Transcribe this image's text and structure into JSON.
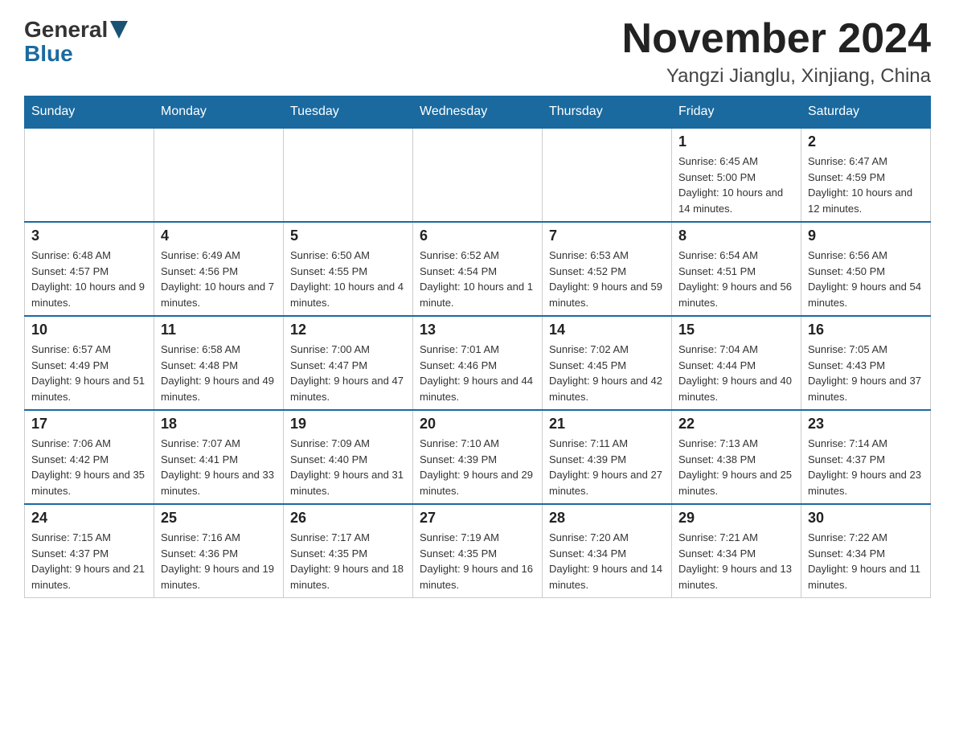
{
  "header": {
    "month_title": "November 2024",
    "location": "Yangzi Jianglu, Xinjiang, China",
    "logo_general": "General",
    "logo_blue": "Blue"
  },
  "weekdays": [
    "Sunday",
    "Monday",
    "Tuesday",
    "Wednesday",
    "Thursday",
    "Friday",
    "Saturday"
  ],
  "weeks": [
    [
      {
        "day": "",
        "sunrise": "",
        "sunset": "",
        "daylight": ""
      },
      {
        "day": "",
        "sunrise": "",
        "sunset": "",
        "daylight": ""
      },
      {
        "day": "",
        "sunrise": "",
        "sunset": "",
        "daylight": ""
      },
      {
        "day": "",
        "sunrise": "",
        "sunset": "",
        "daylight": ""
      },
      {
        "day": "",
        "sunrise": "",
        "sunset": "",
        "daylight": ""
      },
      {
        "day": "1",
        "sunrise": "Sunrise: 6:45 AM",
        "sunset": "Sunset: 5:00 PM",
        "daylight": "Daylight: 10 hours and 14 minutes."
      },
      {
        "day": "2",
        "sunrise": "Sunrise: 6:47 AM",
        "sunset": "Sunset: 4:59 PM",
        "daylight": "Daylight: 10 hours and 12 minutes."
      }
    ],
    [
      {
        "day": "3",
        "sunrise": "Sunrise: 6:48 AM",
        "sunset": "Sunset: 4:57 PM",
        "daylight": "Daylight: 10 hours and 9 minutes."
      },
      {
        "day": "4",
        "sunrise": "Sunrise: 6:49 AM",
        "sunset": "Sunset: 4:56 PM",
        "daylight": "Daylight: 10 hours and 7 minutes."
      },
      {
        "day": "5",
        "sunrise": "Sunrise: 6:50 AM",
        "sunset": "Sunset: 4:55 PM",
        "daylight": "Daylight: 10 hours and 4 minutes."
      },
      {
        "day": "6",
        "sunrise": "Sunrise: 6:52 AM",
        "sunset": "Sunset: 4:54 PM",
        "daylight": "Daylight: 10 hours and 1 minute."
      },
      {
        "day": "7",
        "sunrise": "Sunrise: 6:53 AM",
        "sunset": "Sunset: 4:52 PM",
        "daylight": "Daylight: 9 hours and 59 minutes."
      },
      {
        "day": "8",
        "sunrise": "Sunrise: 6:54 AM",
        "sunset": "Sunset: 4:51 PM",
        "daylight": "Daylight: 9 hours and 56 minutes."
      },
      {
        "day": "9",
        "sunrise": "Sunrise: 6:56 AM",
        "sunset": "Sunset: 4:50 PM",
        "daylight": "Daylight: 9 hours and 54 minutes."
      }
    ],
    [
      {
        "day": "10",
        "sunrise": "Sunrise: 6:57 AM",
        "sunset": "Sunset: 4:49 PM",
        "daylight": "Daylight: 9 hours and 51 minutes."
      },
      {
        "day": "11",
        "sunrise": "Sunrise: 6:58 AM",
        "sunset": "Sunset: 4:48 PM",
        "daylight": "Daylight: 9 hours and 49 minutes."
      },
      {
        "day": "12",
        "sunrise": "Sunrise: 7:00 AM",
        "sunset": "Sunset: 4:47 PM",
        "daylight": "Daylight: 9 hours and 47 minutes."
      },
      {
        "day": "13",
        "sunrise": "Sunrise: 7:01 AM",
        "sunset": "Sunset: 4:46 PM",
        "daylight": "Daylight: 9 hours and 44 minutes."
      },
      {
        "day": "14",
        "sunrise": "Sunrise: 7:02 AM",
        "sunset": "Sunset: 4:45 PM",
        "daylight": "Daylight: 9 hours and 42 minutes."
      },
      {
        "day": "15",
        "sunrise": "Sunrise: 7:04 AM",
        "sunset": "Sunset: 4:44 PM",
        "daylight": "Daylight: 9 hours and 40 minutes."
      },
      {
        "day": "16",
        "sunrise": "Sunrise: 7:05 AM",
        "sunset": "Sunset: 4:43 PM",
        "daylight": "Daylight: 9 hours and 37 minutes."
      }
    ],
    [
      {
        "day": "17",
        "sunrise": "Sunrise: 7:06 AM",
        "sunset": "Sunset: 4:42 PM",
        "daylight": "Daylight: 9 hours and 35 minutes."
      },
      {
        "day": "18",
        "sunrise": "Sunrise: 7:07 AM",
        "sunset": "Sunset: 4:41 PM",
        "daylight": "Daylight: 9 hours and 33 minutes."
      },
      {
        "day": "19",
        "sunrise": "Sunrise: 7:09 AM",
        "sunset": "Sunset: 4:40 PM",
        "daylight": "Daylight: 9 hours and 31 minutes."
      },
      {
        "day": "20",
        "sunrise": "Sunrise: 7:10 AM",
        "sunset": "Sunset: 4:39 PM",
        "daylight": "Daylight: 9 hours and 29 minutes."
      },
      {
        "day": "21",
        "sunrise": "Sunrise: 7:11 AM",
        "sunset": "Sunset: 4:39 PM",
        "daylight": "Daylight: 9 hours and 27 minutes."
      },
      {
        "day": "22",
        "sunrise": "Sunrise: 7:13 AM",
        "sunset": "Sunset: 4:38 PM",
        "daylight": "Daylight: 9 hours and 25 minutes."
      },
      {
        "day": "23",
        "sunrise": "Sunrise: 7:14 AM",
        "sunset": "Sunset: 4:37 PM",
        "daylight": "Daylight: 9 hours and 23 minutes."
      }
    ],
    [
      {
        "day": "24",
        "sunrise": "Sunrise: 7:15 AM",
        "sunset": "Sunset: 4:37 PM",
        "daylight": "Daylight: 9 hours and 21 minutes."
      },
      {
        "day": "25",
        "sunrise": "Sunrise: 7:16 AM",
        "sunset": "Sunset: 4:36 PM",
        "daylight": "Daylight: 9 hours and 19 minutes."
      },
      {
        "day": "26",
        "sunrise": "Sunrise: 7:17 AM",
        "sunset": "Sunset: 4:35 PM",
        "daylight": "Daylight: 9 hours and 18 minutes."
      },
      {
        "day": "27",
        "sunrise": "Sunrise: 7:19 AM",
        "sunset": "Sunset: 4:35 PM",
        "daylight": "Daylight: 9 hours and 16 minutes."
      },
      {
        "day": "28",
        "sunrise": "Sunrise: 7:20 AM",
        "sunset": "Sunset: 4:34 PM",
        "daylight": "Daylight: 9 hours and 14 minutes."
      },
      {
        "day": "29",
        "sunrise": "Sunrise: 7:21 AM",
        "sunset": "Sunset: 4:34 PM",
        "daylight": "Daylight: 9 hours and 13 minutes."
      },
      {
        "day": "30",
        "sunrise": "Sunrise: 7:22 AM",
        "sunset": "Sunset: 4:34 PM",
        "daylight": "Daylight: 9 hours and 11 minutes."
      }
    ]
  ]
}
